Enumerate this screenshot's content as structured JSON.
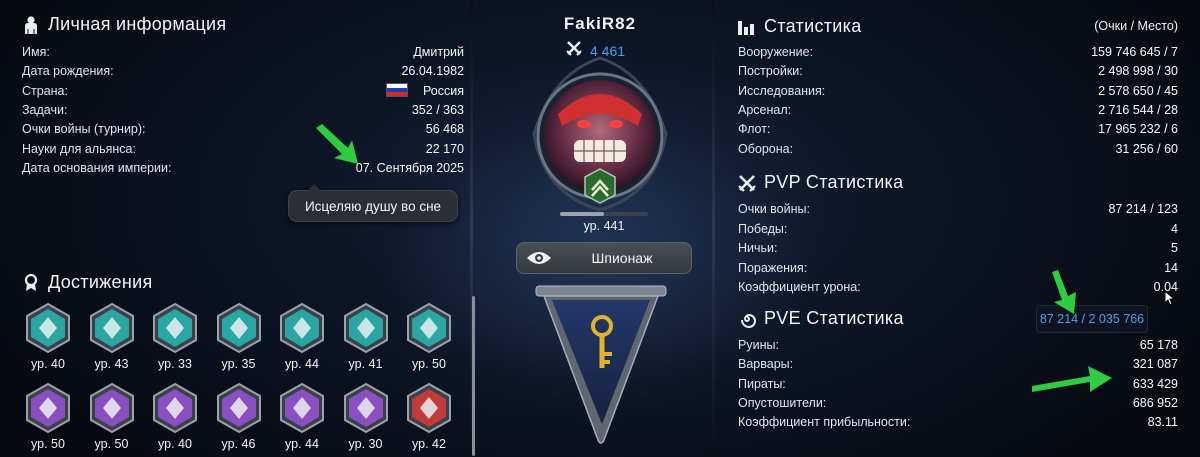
{
  "colors": {
    "accent_green": "#2ecc40",
    "link_blue": "#4aa0e8",
    "panel_bg": "#0c1424"
  },
  "personal": {
    "title": "Личная информация",
    "icon": "person-icon",
    "rows": [
      {
        "label": "Имя:",
        "value": "Дмитрий"
      },
      {
        "label": "Дата рождения:",
        "value": "26.04.1982"
      },
      {
        "label": "Страна:",
        "value": "Россия"
      },
      {
        "label": "Задачи:",
        "value": "352 / 363"
      },
      {
        "label": "Очки войны (турнир):",
        "value": "56 468"
      },
      {
        "label": "Науки для альянса:",
        "value": "22 170"
      },
      {
        "label": "Дата основания империи:",
        "value": "07. Сентября 2025"
      }
    ],
    "motto": "Исцеляю душу во сне"
  },
  "achievements": {
    "title": "Достижения",
    "icon": "award-icon",
    "items": [
      {
        "level": "ур. 40",
        "icon": "pyramid-icon",
        "color": "#2aa7a3"
      },
      {
        "level": "ур. 43",
        "icon": "buildings-icon",
        "color": "#2aa7a3"
      },
      {
        "level": "ур. 33",
        "icon": "scales-icon",
        "color": "#2aa7a3"
      },
      {
        "level": "ур. 35",
        "icon": "coins-icon",
        "color": "#2aa7a3"
      },
      {
        "level": "ур. 44",
        "icon": "chevrons-icon",
        "color": "#2aa7a3"
      },
      {
        "level": "ур. 41",
        "icon": "dna-icon",
        "color": "#2aa7a3"
      },
      {
        "level": "ур. 50",
        "icon": "medal-icon",
        "color": "#2aa7a3"
      },
      {
        "level": "ур. 50",
        "icon": "vortex-icon",
        "color": "#8a4fc0"
      },
      {
        "level": "ур. 50",
        "icon": "ship-icon",
        "color": "#8a4fc0"
      },
      {
        "level": "ур. 40",
        "icon": "ring-icon",
        "color": "#8a4fc0"
      },
      {
        "level": "ур. 46",
        "icon": "blades-icon",
        "color": "#8a4fc0"
      },
      {
        "level": "ур. 44",
        "icon": "gate-icon",
        "color": "#8a4fc0"
      },
      {
        "level": "ур. 30",
        "icon": "column-icon",
        "color": "#8a4fc0"
      },
      {
        "level": "ур. 42",
        "icon": "emblem-icon",
        "color": "#c23a3a"
      }
    ]
  },
  "profile": {
    "name": "FakiR82",
    "power": "4 461",
    "power_icon": "crossed-swords-icon",
    "level": "ур. 441",
    "level_progress": 0.5,
    "spy_label": "Шпионаж",
    "spy_icon": "eye-icon",
    "banner_icon": "key-icon"
  },
  "stats": {
    "title": "Статистика",
    "hint": "(Очки / Место)",
    "icon": "bar-chart-icon",
    "rows": [
      {
        "label": "Вооружение:",
        "value": "159 746 645 / 7"
      },
      {
        "label": "Постройки:",
        "value": "2 498 998 / 30"
      },
      {
        "label": "Исследования:",
        "value": "2 578 650 / 45"
      },
      {
        "label": "Арсенал:",
        "value": "2 716 544 / 28"
      },
      {
        "label": "Флот:",
        "value": "17 965 232 / 6"
      },
      {
        "label": "Оборона:",
        "value": "31 256 / 60"
      }
    ]
  },
  "pvp": {
    "title": "PVP Статистика",
    "icon": "crossed-swords-icon",
    "rows": [
      {
        "label": "Очки войны:",
        "value": "87 214 / 123"
      },
      {
        "label": "Победы:",
        "value": "4"
      },
      {
        "label": "Ничьи:",
        "value": "5"
      },
      {
        "label": "Поражения:",
        "value": "14"
      },
      {
        "label": "Коэффициент урона:",
        "value": "0.04"
      }
    ],
    "tooltip": "87 214 / 2 035 766"
  },
  "pve": {
    "title": "PVE Статистика",
    "icon": "spiral-icon",
    "rows": [
      {
        "label": "Руины:",
        "value": "65 178"
      },
      {
        "label": "Варвары:",
        "value": "321 087"
      },
      {
        "label": "Пираты:",
        "value": "633 429"
      },
      {
        "label": "Опустошители:",
        "value": "686 952"
      },
      {
        "label": "Коэффициент прибыльности:",
        "value": "83.11"
      }
    ]
  }
}
